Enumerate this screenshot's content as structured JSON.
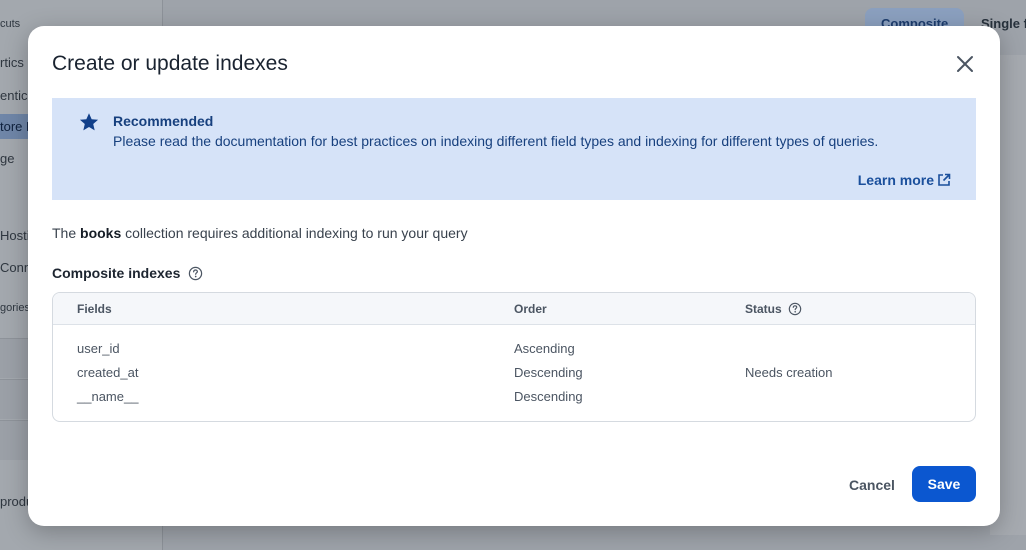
{
  "background": {
    "sidebar_items": [
      {
        "label": "cuts"
      },
      {
        "label": "rtics"
      },
      {
        "label": "entica"
      },
      {
        "label": "tore D"
      },
      {
        "label": "ge"
      },
      {
        "label": "Hosti"
      },
      {
        "label": "Conn"
      },
      {
        "label": "gories"
      },
      {
        "label": "produ"
      }
    ],
    "tabs": [
      "Composite",
      "Single f"
    ]
  },
  "modal": {
    "title": "Create or update indexes",
    "close_icon": "close-icon",
    "banner": {
      "icon": "star-icon",
      "title": "Recommended",
      "text": "Please read the documentation for best practices on indexing different field types and indexing for different types of queries.",
      "link_label": "Learn more",
      "link_icon": "open-in-new-icon"
    },
    "description": {
      "prefix": "The ",
      "collection": "books",
      "suffix": " collection requires additional indexing to run your query"
    },
    "section": {
      "label": "Composite indexes",
      "help_icon": "help-icon"
    },
    "table": {
      "headers": {
        "fields": "Fields",
        "order": "Order",
        "status": "Status"
      },
      "rows": [
        {
          "field": "user_id",
          "order": "Ascending",
          "status": ""
        },
        {
          "field": "created_at",
          "order": "Descending",
          "status": "Needs creation"
        },
        {
          "field": "__name__",
          "order": "Descending",
          "status": ""
        }
      ]
    },
    "actions": {
      "cancel": "Cancel",
      "save": "Save"
    }
  },
  "colors": {
    "primary": "#0b57d0",
    "banner_bg": "#d6e3f8",
    "banner_text": "#17407e"
  }
}
